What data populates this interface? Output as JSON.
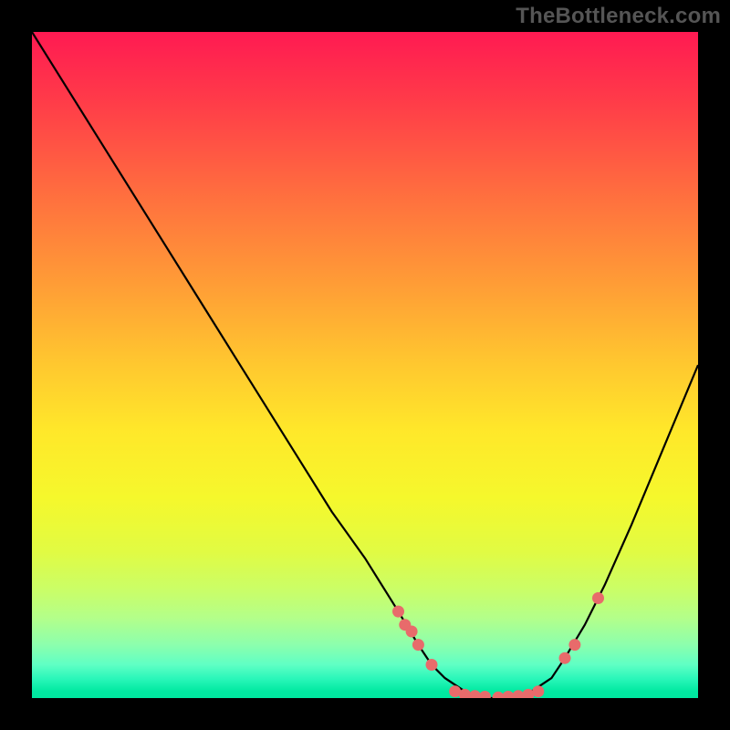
{
  "watermark": "TheBottleneck.com",
  "colors": {
    "frame_bg": "#000000",
    "dot": "#e86b6b",
    "curve": "#000000"
  },
  "chart_data": {
    "type": "line",
    "title": "",
    "xlabel": "",
    "ylabel": "",
    "x_range": [
      0,
      100
    ],
    "y_range": [
      0,
      100
    ],
    "series": [
      {
        "name": "curve",
        "x": [
          0,
          5,
          10,
          15,
          20,
          25,
          30,
          35,
          40,
          45,
          50,
          55,
          58,
          60,
          62,
          65,
          68,
          70,
          72,
          75,
          78,
          80,
          83,
          86,
          90,
          95,
          100
        ],
        "y": [
          100,
          92,
          84,
          76,
          68,
          60,
          52,
          44,
          36,
          28,
          21,
          13,
          8,
          5,
          3,
          1,
          0,
          0,
          0,
          1,
          3,
          6,
          11,
          17,
          26,
          38,
          50
        ]
      }
    ],
    "dots": [
      {
        "x": 55.0,
        "y": 13
      },
      {
        "x": 56.0,
        "y": 11
      },
      {
        "x": 57.0,
        "y": 10
      },
      {
        "x": 58.0,
        "y": 8
      },
      {
        "x": 60.0,
        "y": 5
      },
      {
        "x": 63.5,
        "y": 1
      },
      {
        "x": 65.0,
        "y": 0.5
      },
      {
        "x": 66.5,
        "y": 0.3
      },
      {
        "x": 68.0,
        "y": 0.2
      },
      {
        "x": 70.0,
        "y": 0.1
      },
      {
        "x": 71.5,
        "y": 0.2
      },
      {
        "x": 73.0,
        "y": 0.3
      },
      {
        "x": 74.5,
        "y": 0.5
      },
      {
        "x": 76.0,
        "y": 1
      },
      {
        "x": 80.0,
        "y": 6
      },
      {
        "x": 81.5,
        "y": 8
      },
      {
        "x": 85.0,
        "y": 15
      }
    ],
    "gradient_stops": [
      {
        "pos": 0,
        "color": "#ff1a52"
      },
      {
        "pos": 24,
        "color": "#ff6d3f"
      },
      {
        "pos": 50,
        "color": "#ffc82f"
      },
      {
        "pos": 70,
        "color": "#f5f82c"
      },
      {
        "pos": 88,
        "color": "#b3ff8a"
      },
      {
        "pos": 100,
        "color": "#00e79f"
      }
    ]
  }
}
